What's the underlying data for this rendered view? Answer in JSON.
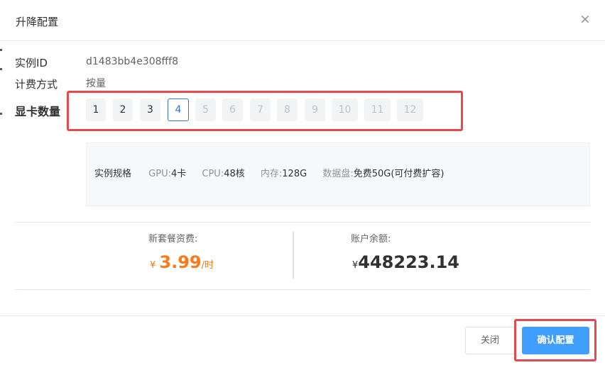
{
  "dialog": {
    "title": "升降配置",
    "close_glyph": "×"
  },
  "instance": {
    "id_label": "实例ID",
    "id_value": "d1483bb4e308fff8",
    "billing_label": "计费方式",
    "billing_value": "按量",
    "gpu_count_label": "显卡数量"
  },
  "gpu_options": [
    {
      "label": "1",
      "state": "enabled"
    },
    {
      "label": "2",
      "state": "enabled"
    },
    {
      "label": "3",
      "state": "enabled"
    },
    {
      "label": "4",
      "state": "selected"
    },
    {
      "label": "5",
      "state": "disabled"
    },
    {
      "label": "6",
      "state": "disabled"
    },
    {
      "label": "7",
      "state": "disabled"
    },
    {
      "label": "8",
      "state": "disabled"
    },
    {
      "label": "9",
      "state": "disabled"
    },
    {
      "label": "10",
      "state": "disabled"
    },
    {
      "label": "11",
      "state": "disabled"
    },
    {
      "label": "12",
      "state": "disabled"
    }
  ],
  "spec": {
    "title": "实例规格",
    "gpu_key": "GPU:",
    "gpu_value": "4卡",
    "cpu_key": "CPU:",
    "cpu_value": "48核",
    "memory_key": "内存:",
    "memory_value": "128G",
    "disk_key": "数据盘:",
    "disk_value": "免费50G(可付费扩容)"
  },
  "pricing": {
    "new_fee_label": "新套餐资费:",
    "currency": "¥",
    "new_fee_value": "3.99",
    "new_fee_unit": "/时",
    "balance_label": "账户余额:",
    "balance_value": "448223.14"
  },
  "footer": {
    "close_label": "关闭",
    "confirm_label": "确认配置"
  },
  "colors": {
    "accent_blue": "#409eff",
    "selected_border": "#3a6fe0",
    "price_orange": "#fa7a1a",
    "highlight_red": "#e5484d"
  }
}
